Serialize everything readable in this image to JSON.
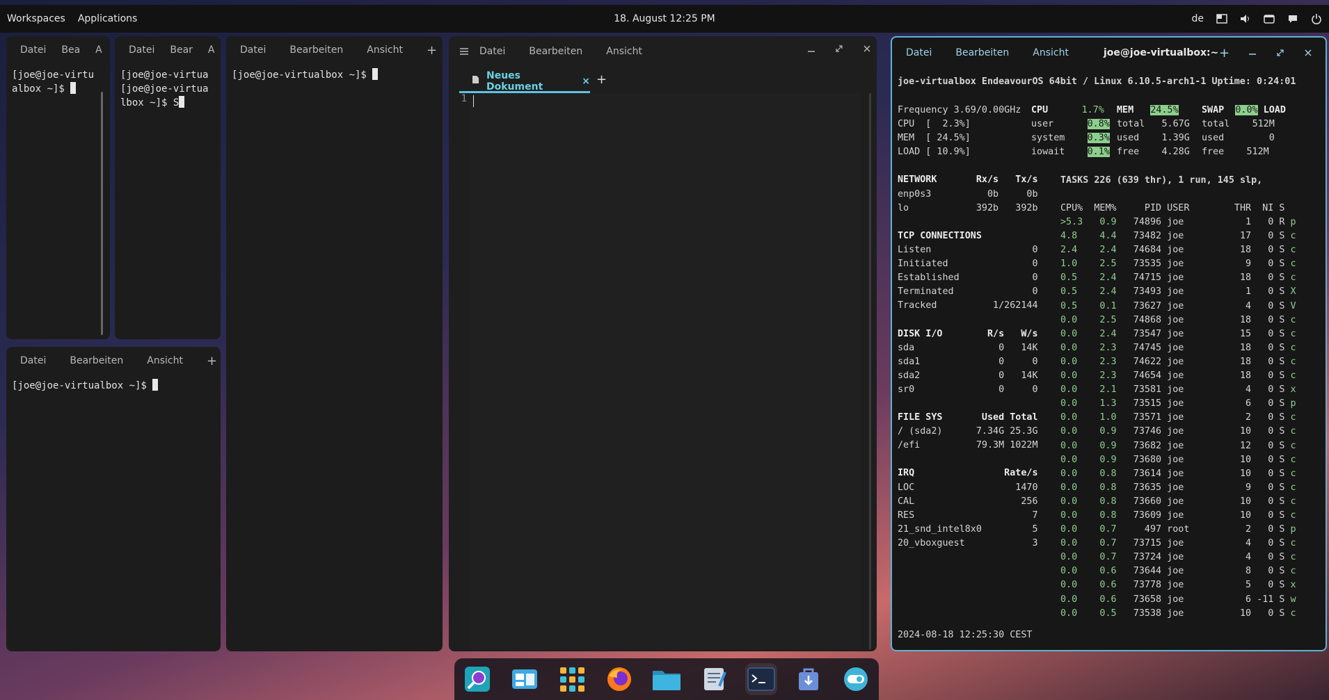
{
  "topbar": {
    "workspaces": "Workspaces",
    "applications": "Applications",
    "datetime": "18. August 12:25 PM",
    "keyboard_layout": "de"
  },
  "term1": {
    "menu": [
      "Datei",
      "Bea",
      "A"
    ],
    "lines": [
      "[joe@joe-virtu",
      "albox ~]$ "
    ]
  },
  "term2": {
    "menu": [
      "Datei",
      "Bear",
      "A"
    ],
    "lines": [
      "[joe@joe-virtua",
      "[joe@joe-virtua",
      "lbox ~]$ S"
    ]
  },
  "term3": {
    "menu": [
      "Datei",
      "Bearbeiten",
      "Ansicht"
    ],
    "add": "+",
    "prompt": "[joe@joe-virtualbox ~]$ "
  },
  "term4": {
    "menu": [
      "Datei",
      "Bearbeiten",
      "Ansicht"
    ],
    "add": "+",
    "prompt": "[joe@joe-virtualbox ~]$ "
  },
  "editor": {
    "menu": [
      "Datei",
      "Bearbeiten",
      "Ansicht"
    ],
    "tab_label": "Neues Dokument",
    "tab_close": "×",
    "new_tab": "+",
    "line_number": "1"
  },
  "btop": {
    "menu": [
      "Datei",
      "Bearbeiten",
      "Ansicht"
    ],
    "title": "joe@joe-virtualbox:~",
    "add": "+",
    "sysline": "joe-virtualbox EndeavourOS 64bit / Linux 6.10.5-arch1-1 Uptime: 0:24:01",
    "footer": "2024-08-18 12:25:30 CEST",
    "left_lines": [
      "Frequency 3.69/0.00GHz",
      "CPU  [  2.3%]",
      "MEM  [ 24.5%]",
      "LOAD [ 10.9%]",
      "",
      "NETWORK       Rx/s   Tx/s",
      "enp0s3          0b     0b",
      "lo            392b   392b",
      "",
      "TCP CONNECTIONS",
      "Listen                  0",
      "Initiated               0",
      "Established             0",
      "Terminated              0",
      "Tracked          1/262144",
      "",
      "DISK I/O        R/s   W/s",
      "sda               0   14K",
      "sda1              0     0",
      "sda2              0   14K",
      "sr0               0     0",
      "",
      "FILE SYS       Used Total",
      "/ (sda2)      7.34G 25.3G",
      "/efi          79.3M 1022M",
      "",
      "IRQ                Rate/s",
      "LOC                  1470",
      "CAL                   256",
      "RES                     7",
      "21_snd_intel8x0         5",
      "20_vboxguest            3"
    ],
    "cpu_header": [
      "CPU",
      "1.7%"
    ],
    "cpu_rows": [
      [
        "user",
        "0.8%"
      ],
      [
        "system",
        "0.3%"
      ],
      [
        "iowait",
        "0.1%"
      ]
    ],
    "mem_header": [
      "MEM",
      "24.5%"
    ],
    "mem_rows": [
      [
        "total",
        "5.67G"
      ],
      [
        "used",
        "1.39G"
      ],
      [
        "free",
        "4.28G"
      ]
    ],
    "swap_header": [
      "SWAP",
      "0.0%"
    ],
    "swap_rows": [
      [
        "total",
        "512M"
      ],
      [
        "used",
        "0"
      ],
      [
        "free",
        "512M"
      ]
    ],
    "load_label": "LOAD",
    "tasks_line": "TASKS 226 (639 thr), 1 run, 145 slp,",
    "proc_header": "CPU%  MEM%     PID USER        THR  NI S",
    "processes": [
      [
        ">5.3",
        "0.9",
        "74896",
        "joe",
        "1",
        "0",
        "R",
        "p"
      ],
      [
        "4.8",
        "4.4",
        "73482",
        "joe",
        "17",
        "0",
        "S",
        "c"
      ],
      [
        "2.4",
        "2.4",
        "74684",
        "joe",
        "18",
        "0",
        "S",
        "c"
      ],
      [
        "1.0",
        "2.5",
        "73535",
        "joe",
        "9",
        "0",
        "S",
        "c"
      ],
      [
        "0.5",
        "2.4",
        "74715",
        "joe",
        "18",
        "0",
        "S",
        "c"
      ],
      [
        "0.5",
        "2.4",
        "73493",
        "joe",
        "1",
        "0",
        "S",
        "X"
      ],
      [
        "0.5",
        "0.1",
        "73627",
        "joe",
        "4",
        "0",
        "S",
        "V"
      ],
      [
        "0.0",
        "2.5",
        "74868",
        "joe",
        "18",
        "0",
        "S",
        "c"
      ],
      [
        "0.0",
        "2.4",
        "73547",
        "joe",
        "15",
        "0",
        "S",
        "c"
      ],
      [
        "0.0",
        "2.3",
        "74745",
        "joe",
        "18",
        "0",
        "S",
        "c"
      ],
      [
        "0.0",
        "2.3",
        "74622",
        "joe",
        "18",
        "0",
        "S",
        "c"
      ],
      [
        "0.0",
        "2.3",
        "74654",
        "joe",
        "18",
        "0",
        "S",
        "c"
      ],
      [
        "0.0",
        "2.1",
        "73581",
        "joe",
        "4",
        "0",
        "S",
        "x"
      ],
      [
        "0.0",
        "1.3",
        "73515",
        "joe",
        "6",
        "0",
        "S",
        "p"
      ],
      [
        "0.0",
        "1.0",
        "73571",
        "joe",
        "2",
        "0",
        "S",
        "c"
      ],
      [
        "0.0",
        "0.9",
        "73746",
        "joe",
        "10",
        "0",
        "S",
        "c"
      ],
      [
        "0.0",
        "0.9",
        "73682",
        "joe",
        "12",
        "0",
        "S",
        "c"
      ],
      [
        "0.0",
        "0.9",
        "73680",
        "joe",
        "10",
        "0",
        "S",
        "c"
      ],
      [
        "0.0",
        "0.8",
        "73614",
        "joe",
        "10",
        "0",
        "S",
        "c"
      ],
      [
        "0.0",
        "0.8",
        "73635",
        "joe",
        "9",
        "0",
        "S",
        "c"
      ],
      [
        "0.0",
        "0.8",
        "73660",
        "joe",
        "10",
        "0",
        "S",
        "c"
      ],
      [
        "0.0",
        "0.8",
        "73609",
        "joe",
        "10",
        "0",
        "S",
        "c"
      ],
      [
        "0.0",
        "0.7",
        "497",
        "root",
        "2",
        "0",
        "S",
        "p"
      ],
      [
        "0.0",
        "0.7",
        "73715",
        "joe",
        "4",
        "0",
        "S",
        "c"
      ],
      [
        "0.0",
        "0.7",
        "73724",
        "joe",
        "4",
        "0",
        "S",
        "c"
      ],
      [
        "0.0",
        "0.6",
        "73644",
        "joe",
        "8",
        "0",
        "S",
        "c"
      ],
      [
        "0.0",
        "0.6",
        "73778",
        "joe",
        "5",
        "0",
        "S",
        "x"
      ],
      [
        "0.0",
        "0.6",
        "73658",
        "joe",
        "6",
        "-11",
        "S",
        "w"
      ],
      [
        "0.0",
        "0.5",
        "73538",
        "joe",
        "10",
        "0",
        "S",
        "c"
      ]
    ]
  },
  "dock": [
    "search-app-icon",
    "file-manager-grid-icon",
    "app-grid-icon",
    "firefox-icon",
    "files-folder-icon",
    "text-editor-icon",
    "terminal-icon",
    "software-store-icon",
    "settings-toggle-icon"
  ],
  "colors": {
    "accent": "#5fb3d6",
    "btop_green": "#8ccf8c",
    "panel_bg": "#1c1c1c"
  }
}
